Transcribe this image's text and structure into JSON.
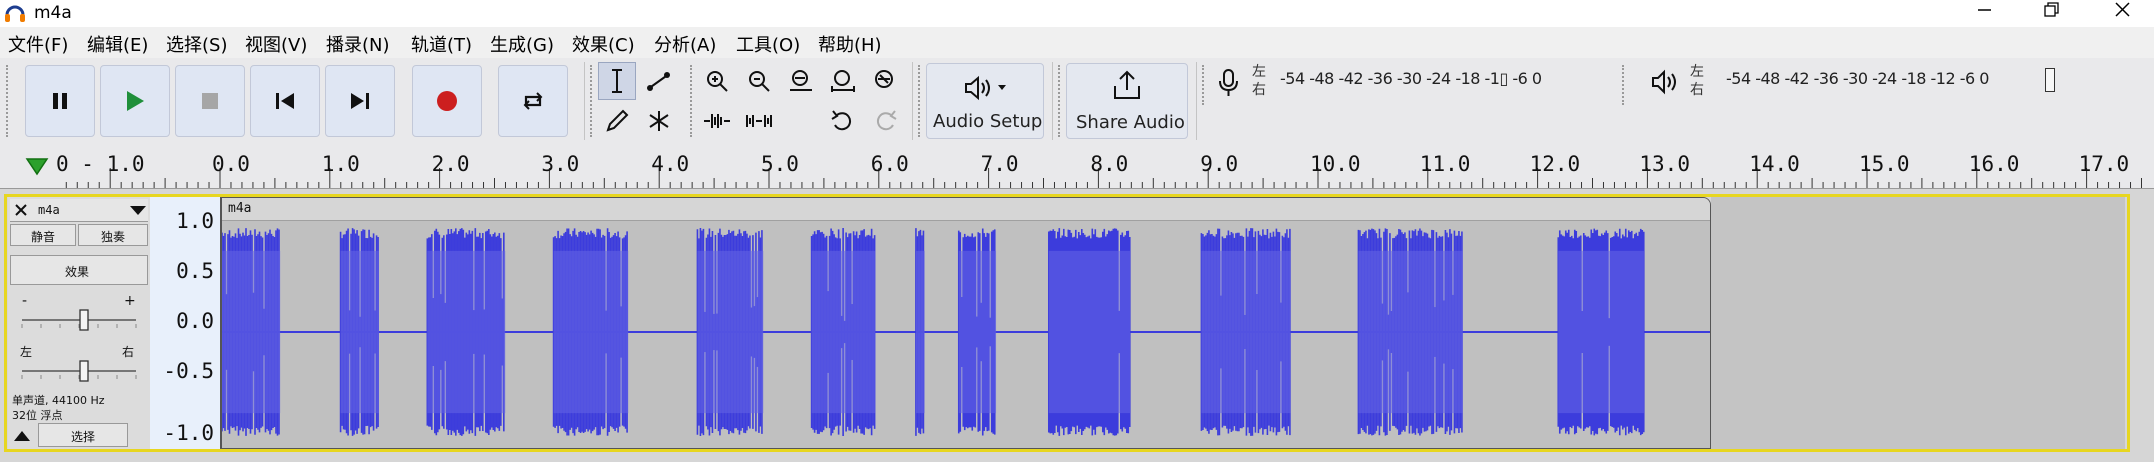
{
  "window": {
    "title": "m4a"
  },
  "menu": [
    "文件(F)",
    "编辑(E)",
    "选择(S)",
    "视图(V)",
    "播录(N)",
    "轨道(T)",
    "生成(G)",
    "效果(C)",
    "分析(A)",
    "工具(O)",
    "帮助(H)"
  ],
  "toolbar": {
    "audio_setup": "Audio Setup",
    "share_audio": "Share Audio",
    "meter_left": "左",
    "meter_right": "右",
    "record_ticks": "-54 -48 -42 -36 -30 -24 -18 -1▯ -6  0",
    "play_ticks": "-54 -48 -42 -36 -30 -24 -18 -12  -6  0"
  },
  "ruler": {
    "labels": [
      "0 - 1.0",
      "0.0",
      "1.0",
      "2.0",
      "3.0",
      "4.0",
      "5.0",
      "6.0",
      "7.0",
      "8.0",
      "9.0",
      "10.0",
      "11.0",
      "12.0",
      "13.0",
      "14.0",
      "15.0",
      "16.0",
      "17.0"
    ]
  },
  "track": {
    "name": "m4a",
    "mute": "静音",
    "solo": "独奏",
    "effects": "效果",
    "gain_minus": "-",
    "gain_plus": "+",
    "pan_left": "左",
    "pan_right": "右",
    "info_line1": "单声道, 44100 Hz",
    "info_line2": "32位 浮点",
    "select": "选择",
    "clip_name": "m4a",
    "vscale": [
      "1.0",
      "0.5",
      "0.0",
      "-0.5",
      "-1.0"
    ]
  },
  "colors": {
    "waveform": "#3c3cdc",
    "waveform_rms": "#6464e6",
    "selection_outline": "#e7d620",
    "button_face": "#dfe6f3"
  },
  "audio": {
    "duration_s": 13.6,
    "bursts_s": [
      [
        0.0,
        0.53
      ],
      [
        1.08,
        1.43
      ],
      [
        1.87,
        2.58
      ],
      [
        3.02,
        3.7
      ],
      [
        4.33,
        4.93
      ],
      [
        5.37,
        5.95
      ],
      [
        6.32,
        6.4
      ],
      [
        6.71,
        7.05
      ],
      [
        7.53,
        8.27
      ],
      [
        8.92,
        9.73
      ],
      [
        10.35,
        11.3
      ],
      [
        12.17,
        12.95
      ]
    ]
  }
}
